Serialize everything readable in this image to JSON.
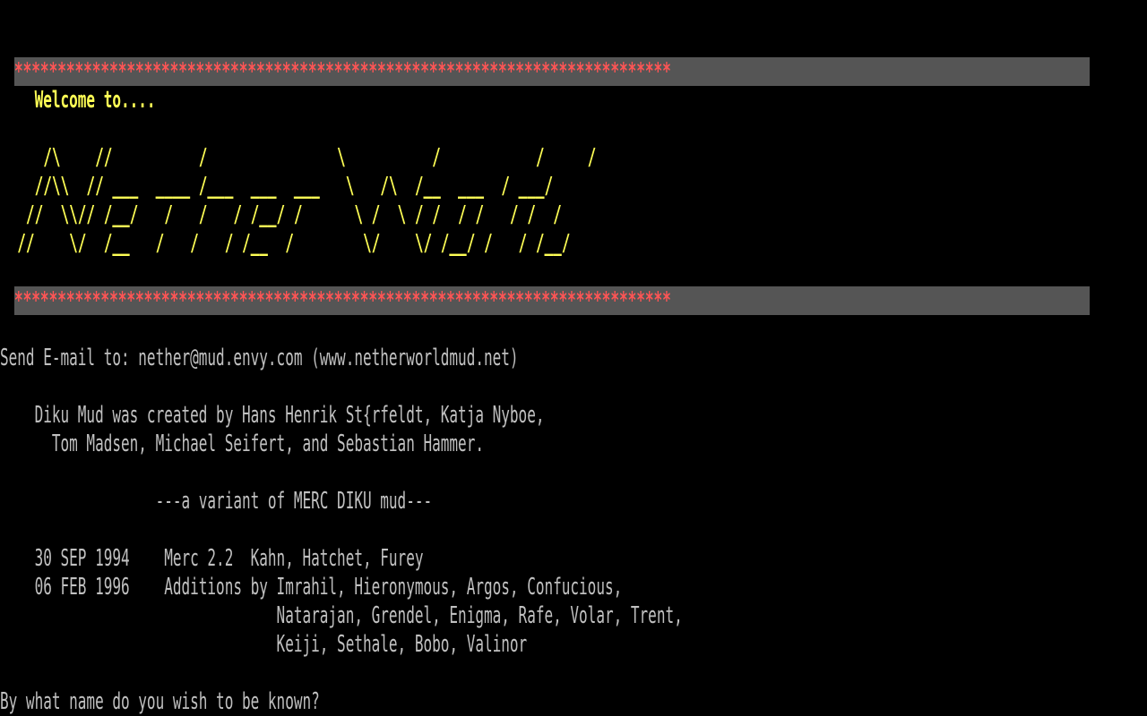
{
  "colors": {
    "background": "#000000",
    "text": "#c0c0c0",
    "yellow": "#ffff55",
    "banner_bg": "#555555",
    "banner_stars": "#ff5555"
  },
  "banner": {
    "stars": "****************************************************************************"
  },
  "welcome": "    Welcome to....",
  "logo": {
    "lines": [
      "     /\\    //          /               \\          /           /     /",
      "    //\\\\  // ___  ____ /___  ___  ___   \\   /\\  /__  ___  / ___/",
      "   //  \\\\// /__/   /   /   / /__/ /      \\ /  \\ / /  / /   / /  /",
      "  //    \\/  /__   /   /   / /__  /        \\/    \\/ /__/ /   / /__/"
    ]
  },
  "email_line": "Send E-mail to: nether@mud.envy.com (www.netherworldmud.net)",
  "credits": {
    "line1": "    Diku Mud was created by Hans Henrik St{rfeldt, Katja Nyboe,",
    "line2": "      Tom Madsen, Michael Seifert, and Sebastian Hammer."
  },
  "variant": "                  ---a variant of MERC DIKU mud---",
  "history": {
    "line1": "    30 SEP 1994    Merc 2.2  Kahn, Hatchet, Furey",
    "line2": "    06 FEB 1996    Additions by Imrahil, Hieronymous, Argos, Confucious,",
    "line3": "                                Natarajan, Grendel, Enigma, Rafe, Volar, Trent,",
    "line4": "                                Keiji, Sethale, Bobo, Valinor"
  },
  "prompt": "By what name do you wish to be known?"
}
